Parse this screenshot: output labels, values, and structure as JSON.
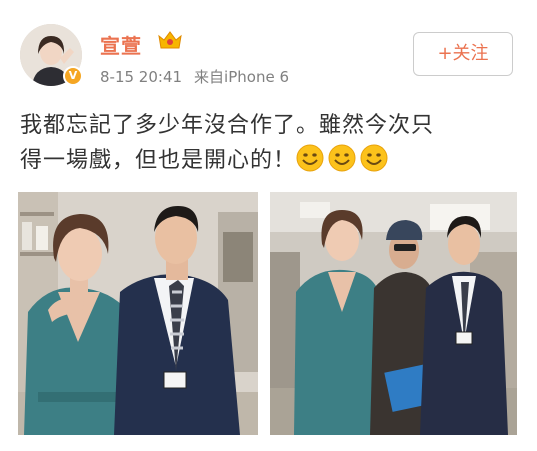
{
  "post": {
    "username": "宣萱",
    "timestamp": "8-15 20:41",
    "source": "来自iPhone 6",
    "follow_label": "+关注",
    "text_line1": "我都忘記了多少年沒合作了。雖然今次只",
    "text_line2": "得一場戲，但也是開心的！",
    "emoji_count": 3,
    "colors": {
      "username": "#eb7350",
      "meta": "#808080",
      "badge": "#f5a623"
    },
    "icons": [
      "verified-badge-icon",
      "vip-crown-icon",
      "smile-emoji-icon"
    ]
  }
}
